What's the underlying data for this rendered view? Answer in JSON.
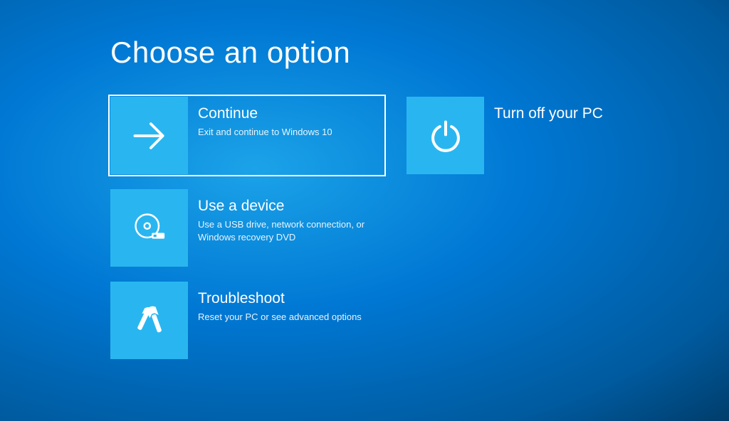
{
  "heading": "Choose an option",
  "options": {
    "continue": {
      "title": "Continue",
      "desc": "Exit and continue to Windows 10"
    },
    "use_device": {
      "title": "Use a device",
      "desc": "Use a USB drive, network connection, or Windows recovery DVD"
    },
    "troubleshoot": {
      "title": "Troubleshoot",
      "desc": "Reset your PC or see advanced options"
    },
    "turn_off": {
      "title": "Turn off your PC"
    }
  }
}
